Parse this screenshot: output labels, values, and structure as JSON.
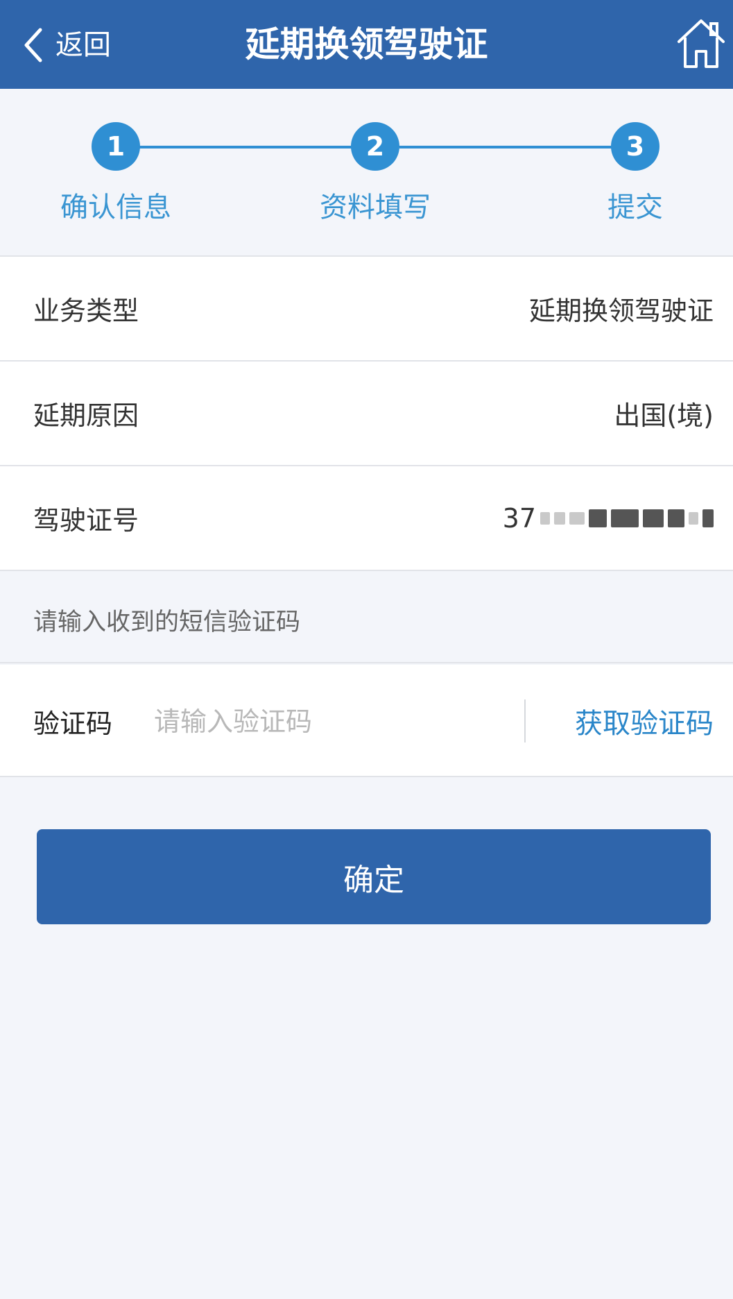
{
  "colors": {
    "header_bg": "#2f65ab",
    "step_accent": "#2f8fd3",
    "step_label": "#3a95d2",
    "link": "#2a86c9",
    "button_bg": "#2f65ab"
  },
  "header": {
    "back_label": "返回",
    "title": "延期换领驾驶证",
    "back_icon": "chevron-left-icon",
    "home_icon": "home-icon"
  },
  "steps": [
    {
      "number": "1",
      "label": "确认信息"
    },
    {
      "number": "2",
      "label": "资料填写"
    },
    {
      "number": "3",
      "label": "提交"
    }
  ],
  "info_rows": [
    {
      "label": "业务类型",
      "value": "延期换领驾驶证"
    },
    {
      "label": "延期原因",
      "value": "出国(境)"
    },
    {
      "label": "驾驶证号",
      "value_visible_prefix": "37"
    }
  ],
  "hint": "请输入收到的短信验证码",
  "code": {
    "label": "验证码",
    "placeholder": "请输入验证码",
    "value": "",
    "get_code_label": "获取验证码"
  },
  "confirm_label": "确定"
}
